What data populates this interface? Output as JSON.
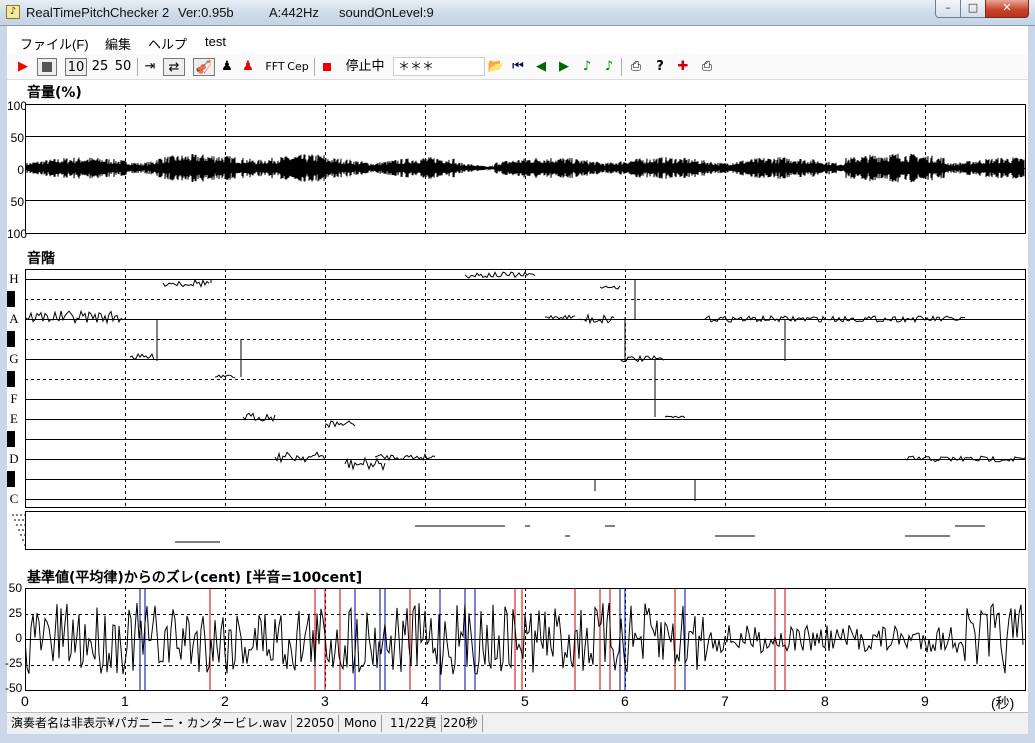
{
  "window": {
    "app_name": "RealTimePitchChecker 2",
    "version": "Ver:0.95b",
    "tuning": "A:442Hz",
    "sound_on_level": "soundOnLevel:9",
    "minimize": "–",
    "maximize": "□",
    "close": "✕"
  },
  "menu": [
    "ファイル(F)",
    "編集",
    "ヘルプ",
    "test"
  ],
  "toolbar": {
    "speed_10": "10",
    "speed_25": "25",
    "speed_50": "50",
    "fft": "FFT",
    "cep": "Cep",
    "state": "停止中",
    "note_display": "＊＊＊"
  },
  "volume_panel": {
    "title": "音量(%)",
    "y_labels": [
      "100",
      "50",
      "0",
      "50",
      "100"
    ]
  },
  "scale_panel": {
    "title": "音階",
    "notes": [
      "H",
      "A",
      "G",
      "F",
      "E",
      "D",
      "C"
    ]
  },
  "cent_panel": {
    "title": "基準値(平均律)からのズレ(cent) [半音=100cent]",
    "y_labels": [
      "50",
      "25",
      "0",
      "-25",
      "-50"
    ]
  },
  "x_axis": {
    "labels": [
      "0",
      "1",
      "2",
      "3",
      "4",
      "5",
      "6",
      "7",
      "8",
      "9"
    ],
    "unit": "(秒)"
  },
  "chart_data": {
    "type": "line",
    "x_unit": "秒",
    "x_range": [
      0,
      9.7
    ],
    "volume_range": [
      -100,
      100
    ],
    "cent_range": [
      -50,
      50
    ]
  },
  "statusbar": {
    "file": "演奏者名は非表示¥パガニーニ・カンタービレ.wav",
    "rate": "22050",
    "channels": "Mono",
    "page": "11/22頁",
    "duration": "220秒"
  }
}
